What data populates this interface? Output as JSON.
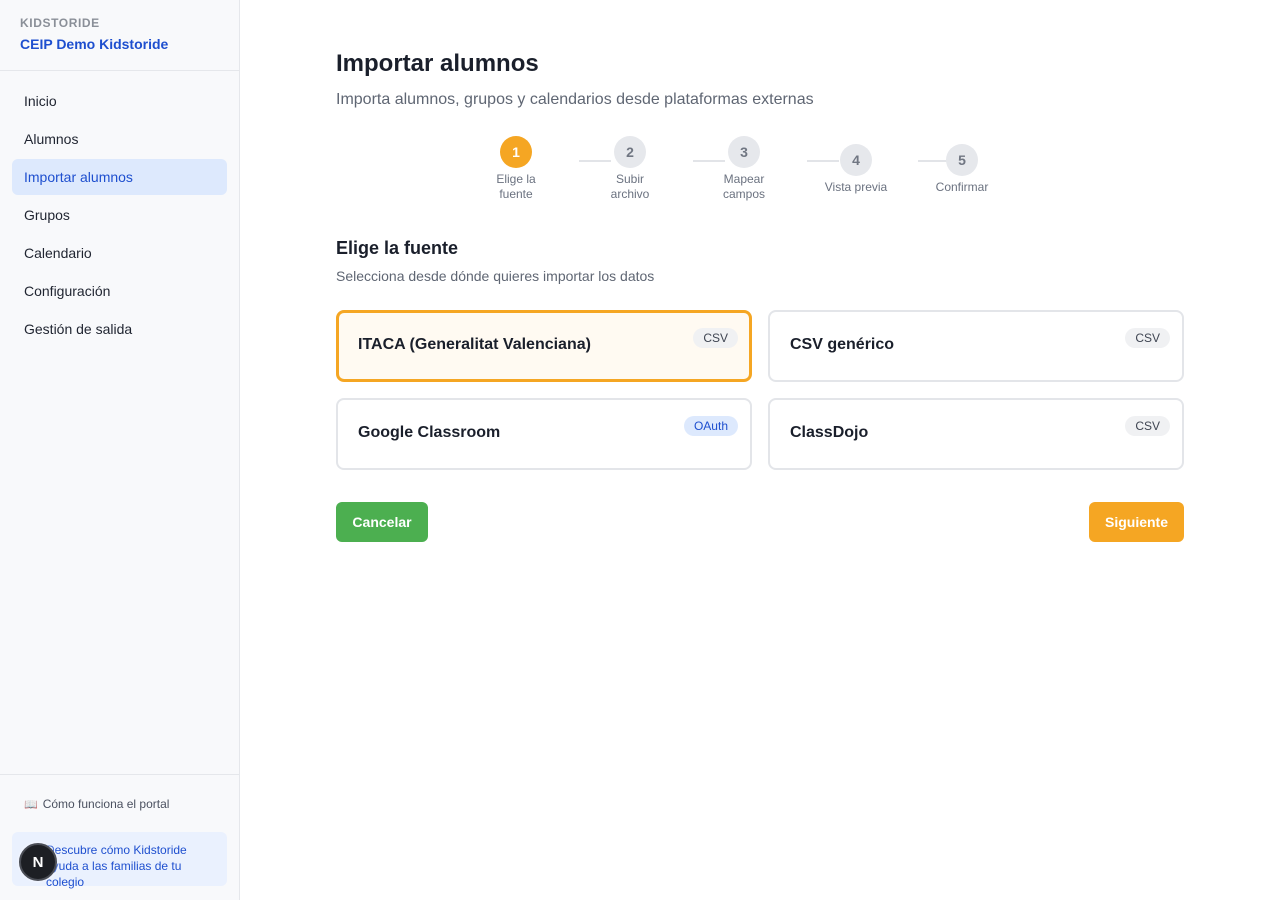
{
  "sidebar": {
    "brand_eyebrow": "KIDSTORIDE",
    "brand_name": "CEIP Demo Kidstoride",
    "items": [
      {
        "label": "Inicio"
      },
      {
        "label": "Alumnos"
      },
      {
        "label": "Importar alumnos",
        "active": true
      },
      {
        "label": "Grupos"
      },
      {
        "label": "Calendario"
      },
      {
        "label": "Configuración"
      },
      {
        "label": "Gestión de salida"
      }
    ],
    "help_icon": "📖",
    "help_link": "Cómo funciona el portal",
    "promo_text": "Descubre cómo Kidstoride ayuda a las familias de tu colegio",
    "avatar_initial": "N"
  },
  "main": {
    "title": "Importar alumnos",
    "subtitle": "Importa alumnos, grupos y calendarios desde plataformas externas",
    "steps": [
      {
        "number": "1",
        "label": "Elige la fuente",
        "active": true
      },
      {
        "number": "2",
        "label": "Subir archivo"
      },
      {
        "number": "3",
        "label": "Mapear campos"
      },
      {
        "number": "4",
        "label": "Vista previa"
      },
      {
        "number": "5",
        "label": "Confirmar"
      }
    ],
    "section_title": "Elige la fuente",
    "section_subtitle": "Selecciona desde dónde quieres importar los datos",
    "sources": [
      {
        "name": "ITACA (Generalitat Valenciana)",
        "badge": "CSV",
        "selected": true
      },
      {
        "name": "CSV genérico",
        "badge": "CSV"
      },
      {
        "name": "Google Classroom",
        "badge": "OAuth"
      },
      {
        "name": "ClassDojo",
        "badge": "CSV"
      }
    ],
    "cancel_label": "Cancelar",
    "next_label": "Siguiente"
  },
  "colors": {
    "accent": "#f5a623",
    "primary_blue": "#1e4fcf",
    "cancel_green": "#4caf50"
  }
}
